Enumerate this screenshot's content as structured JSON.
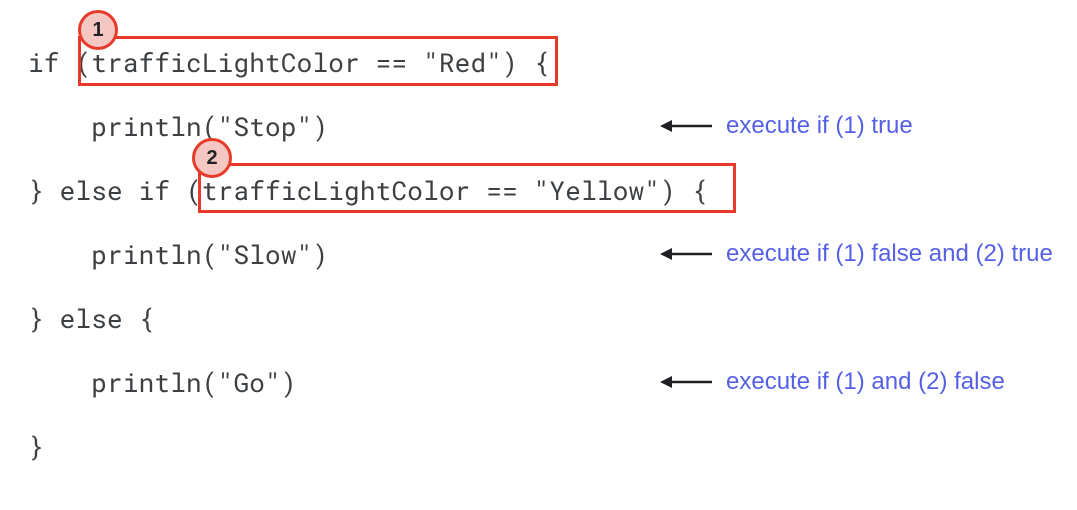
{
  "code": {
    "line1_if": "if ",
    "line1_cond": "(trafficLightColor == \"Red\")",
    "line1_brace": " {",
    "line2_indent": "    ",
    "line2_call": "println(\"Stop\")",
    "line3_else_if": "} else if ",
    "line3_cond": "(trafficLightColor == \"Yellow\")",
    "line3_brace": " {",
    "line4_indent": "    ",
    "line4_call": "println(\"Slow\")",
    "line5": "} else {",
    "line6_indent": "    ",
    "line6_call": "println(\"Go\")",
    "line7": "}"
  },
  "badges": {
    "one": "1",
    "two": "2"
  },
  "annotations": {
    "a1": "execute if (1) true",
    "a2": "execute if (1) false and (2) true",
    "a3": "execute if (1) and (2) false"
  },
  "colors": {
    "code_text": "#3c4043",
    "box_border": "#e83a2a",
    "badge_fill": "#f4c7c3",
    "annotation_text": "#5560e6"
  }
}
